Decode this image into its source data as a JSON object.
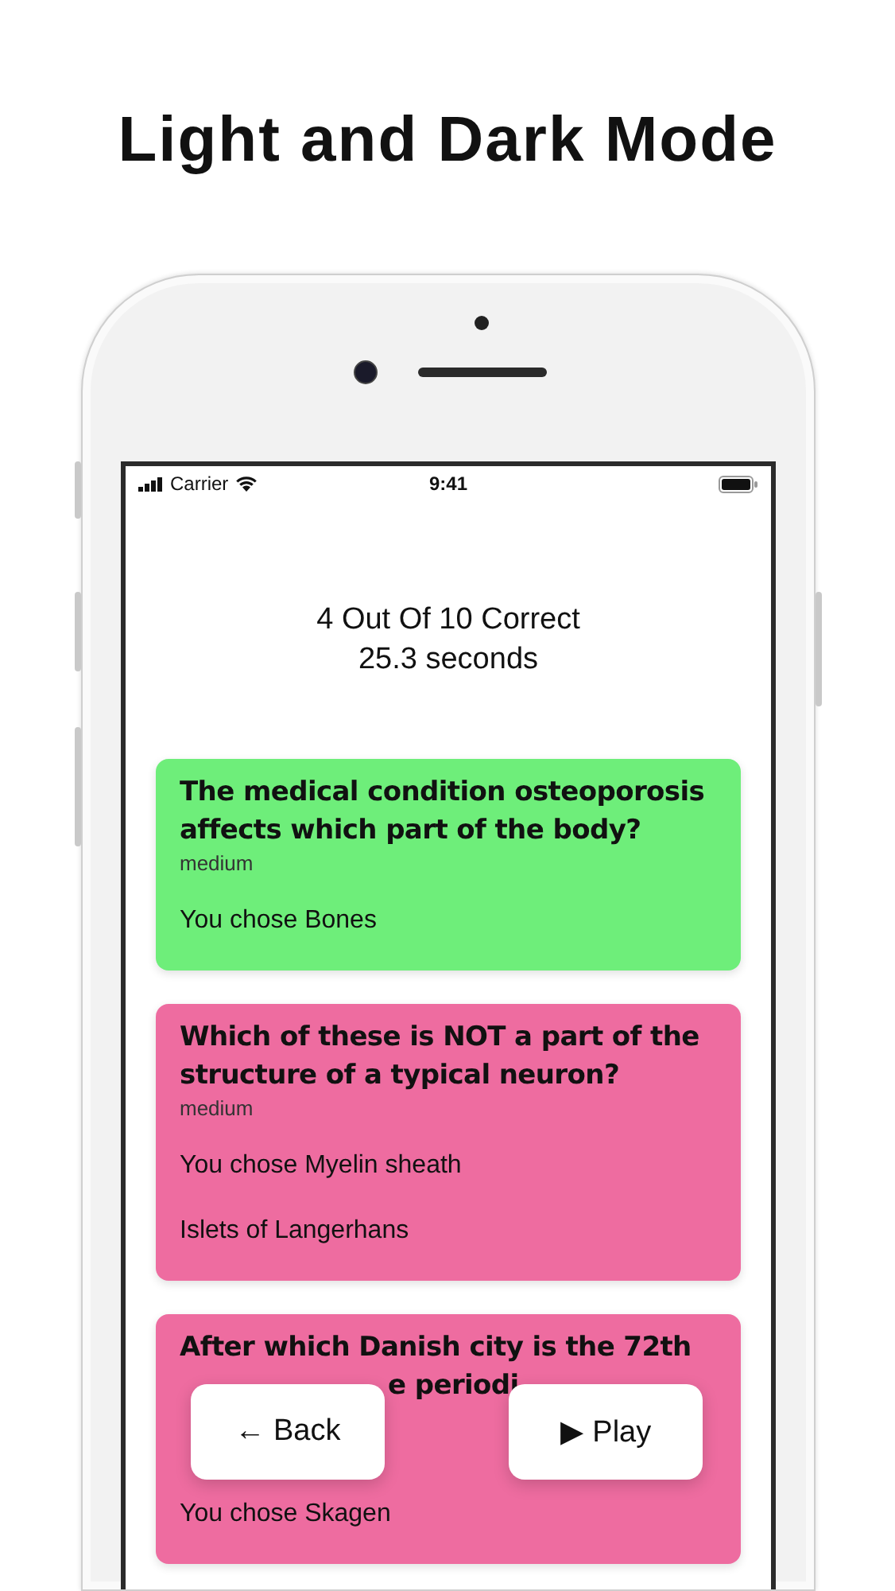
{
  "heading": "Light and Dark Mode",
  "status_bar": {
    "carrier": "Carrier",
    "time": "9:41"
  },
  "summary": {
    "score": "4 Out Of 10 Correct",
    "time": "25.3 seconds"
  },
  "questions": [
    {
      "correct": true,
      "question": "The medical condition osteoporosis affects which part of the body?",
      "difficulty": "medium",
      "choice": "You chose Bones"
    },
    {
      "correct": false,
      "question": "Which of these is NOT a part of the structure of a typical neuron?",
      "difficulty": "medium",
      "choice": "You chose Myelin sheath",
      "answer": "Islets of Langerhans"
    },
    {
      "correct": false,
      "question": "After which Danish city is the 72th",
      "question_fragment": "e periodi",
      "choice": "You chose Skagen"
    }
  ],
  "buttons": [
    {
      "label": "← Back"
    },
    {
      "label": "▶ Play"
    }
  ]
}
